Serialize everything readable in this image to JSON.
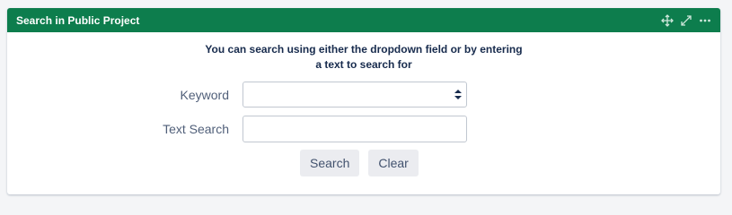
{
  "panel": {
    "title": "Search in Public Project",
    "header_icons": [
      "move-icon",
      "expand-icon",
      "more-icon"
    ],
    "header_color": "#0d7d4d"
  },
  "intro": {
    "line1": "You can search using either the dropdown field or by entering",
    "line2": "a text to search for"
  },
  "form": {
    "keyword_label": "Keyword",
    "keyword_value": "",
    "text_search_label": "Text Search",
    "text_search_value": "",
    "search_button": "Search",
    "clear_button": "Clear"
  }
}
